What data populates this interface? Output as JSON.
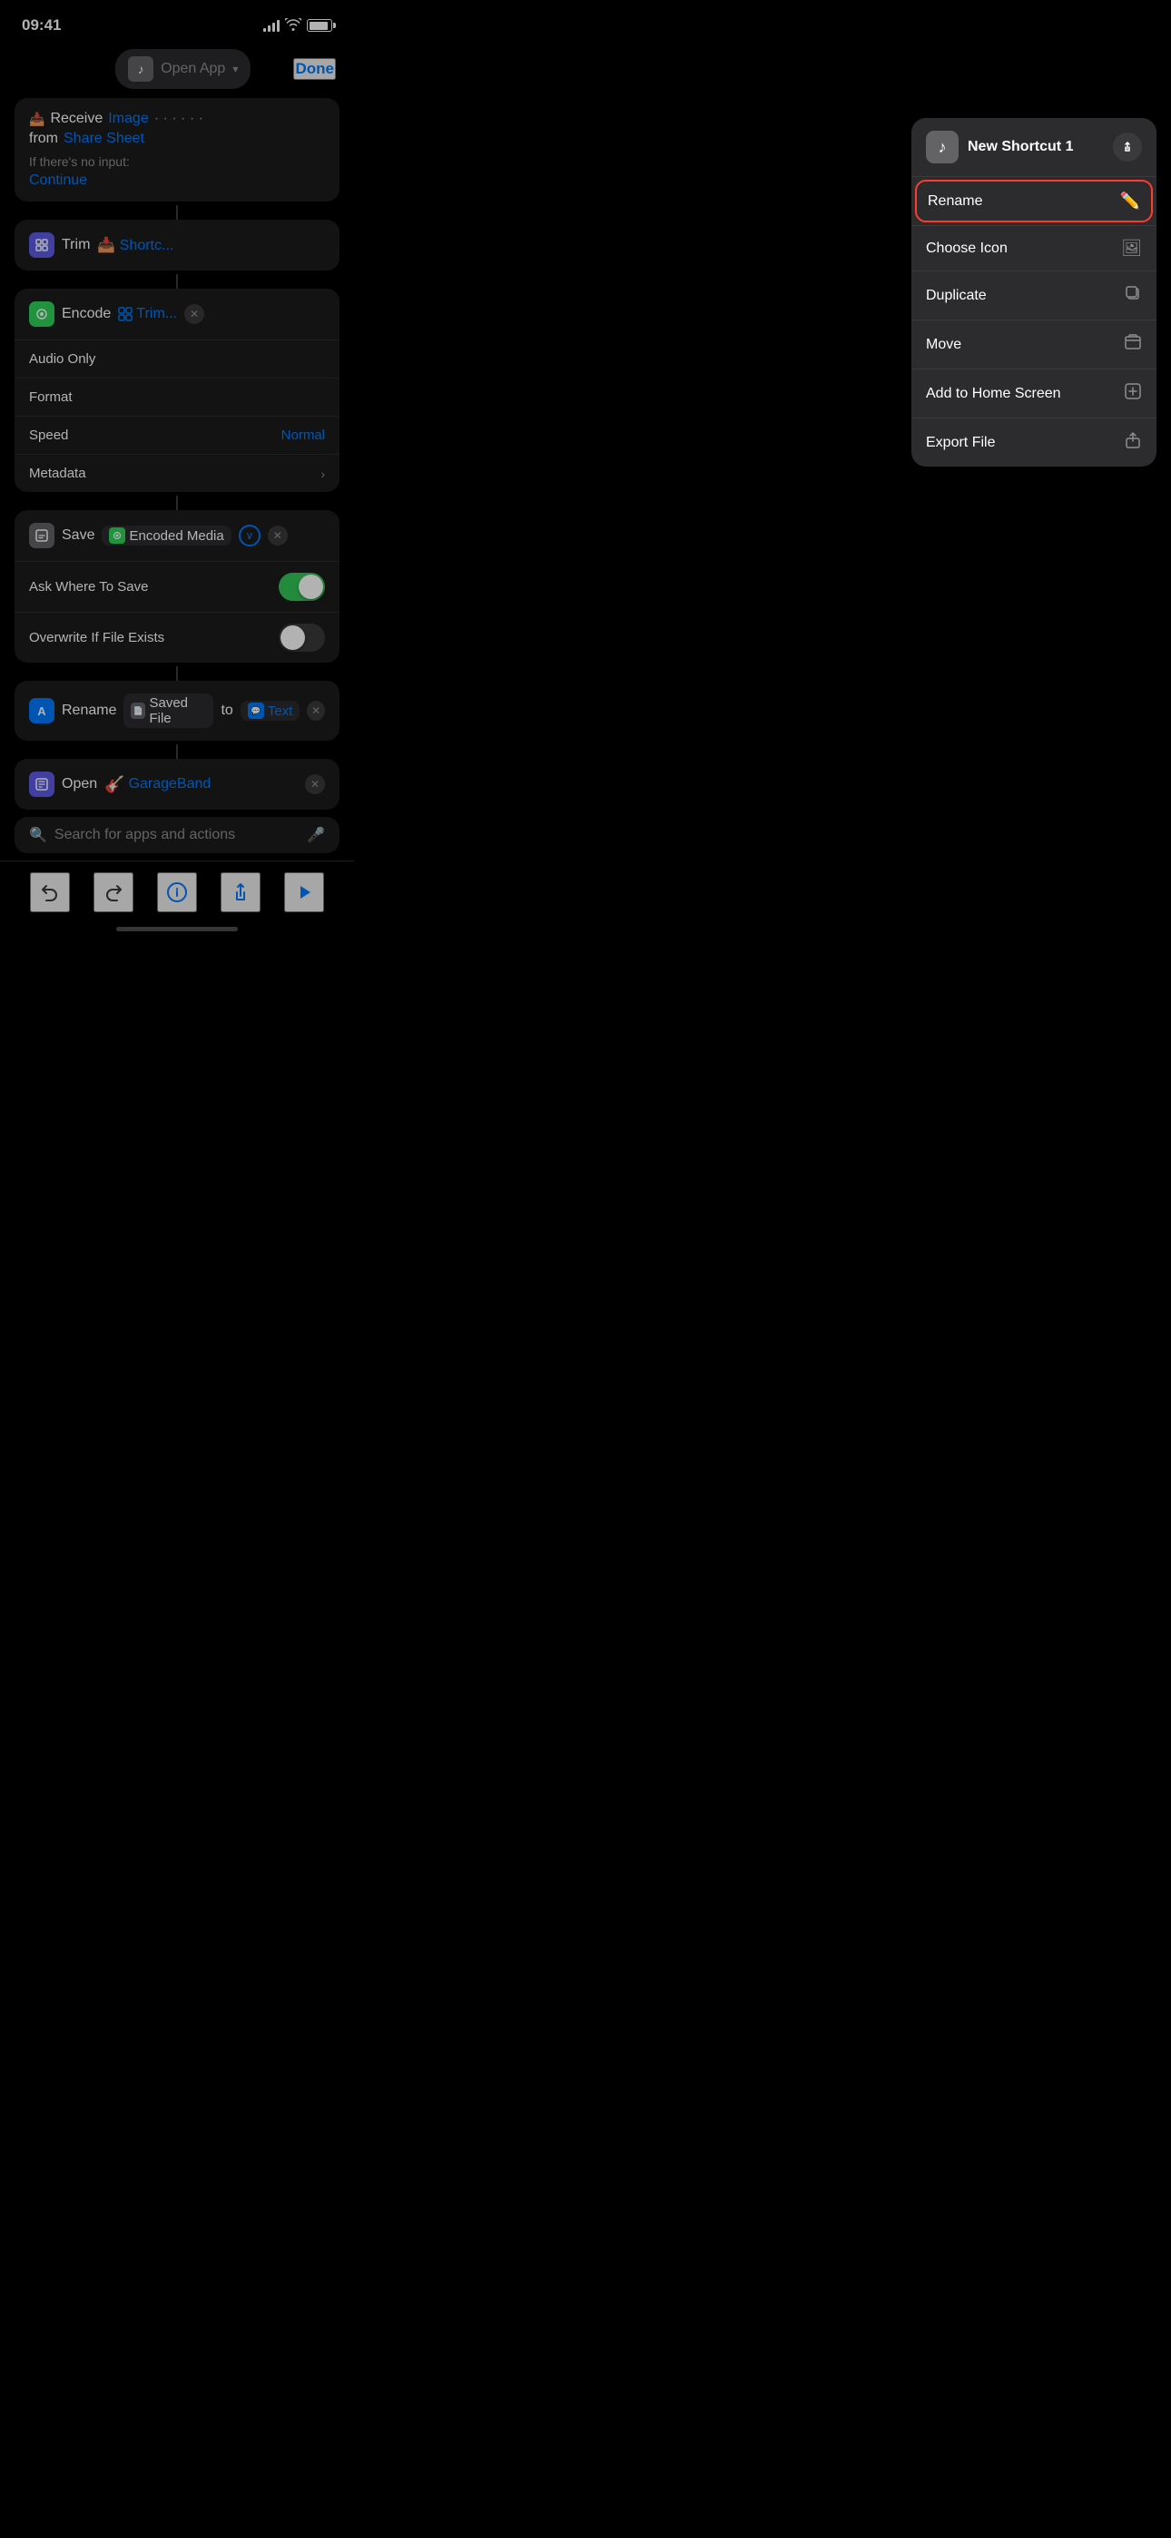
{
  "statusBar": {
    "time": "09:41",
    "signalBars": 4,
    "battery": 90
  },
  "nav": {
    "appIcon": "♪",
    "title": "Open App",
    "chevron": "▾",
    "doneLabel": "Done"
  },
  "receiveBlock": {
    "label": "Receive",
    "type": "Image",
    "fromLabel": "from",
    "shareSheet": "Share Sheet",
    "noInputLabel": "If there's no input:",
    "continueLabel": "Continue"
  },
  "trimBlock": {
    "iconLabel": "⬛",
    "label": "Trim",
    "shortcutLabel": "Shortc..."
  },
  "encodeBlock": {
    "iconLabel": "◉",
    "label": "Encode",
    "trimLabel": "Trim...",
    "audioOnlyLabel": "Audio Only",
    "formatLabel": "Format",
    "speedLabel": "Speed",
    "speedValue": "Normal",
    "metadataLabel": "Metadata",
    "chevron": "›"
  },
  "saveBlock": {
    "iconLabel": "📄",
    "label": "Save",
    "encodedMediaLabel": "Encoded Media",
    "askWhereLabel": "Ask Where To Save",
    "overwriteLabel": "Overwrite If File Exists"
  },
  "renameBlock": {
    "iconLabel": "A",
    "label": "Rename",
    "savedFileLabel": "Saved File",
    "toLabel": "to",
    "textLabel": "Text"
  },
  "openBlock": {
    "iconLabel": "⬛",
    "label": "Open",
    "garageBandLabel": "GarageBand",
    "garageIcon": "🎸"
  },
  "searchBar": {
    "placeholder": "Search for apps and actions",
    "micIcon": "🎤"
  },
  "contextMenu": {
    "appName": "New Shortcut 1",
    "appIcon": "♪",
    "renameLabel": "Rename",
    "renameIcon": "✏️",
    "chooseIconLabel": "Choose Icon",
    "chooseIconIcon": "🖼",
    "duplicateLabel": "Duplicate",
    "duplicateIcon": "⧉",
    "moveLabel": "Move",
    "moveIcon": "🗂",
    "addToHomeLabel": "Add to Home Screen",
    "addToHomeIcon": "⊞",
    "exportFileLabel": "Export File",
    "exportFileIcon": "⬆"
  },
  "toolbar": {
    "undoIcon": "↩",
    "redoIcon": "↪",
    "infoIcon": "ⓘ",
    "shareIcon": "⬆",
    "playIcon": "▶"
  }
}
